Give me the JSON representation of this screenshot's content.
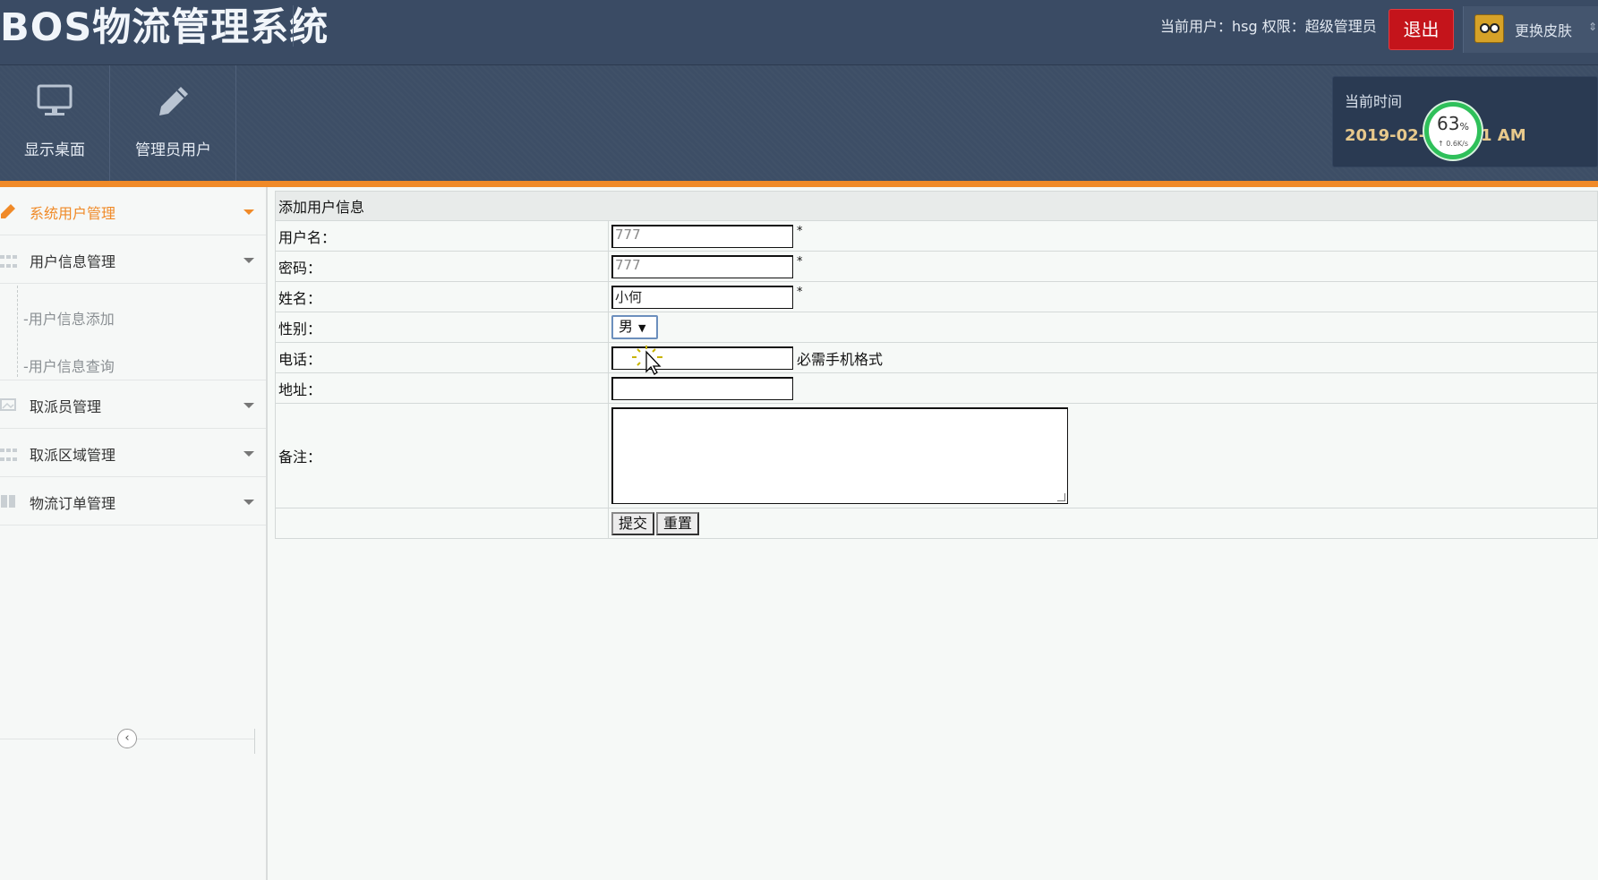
{
  "header": {
    "app_title": "BOS物流管理系统",
    "user_info": "当前用户：hsg  权限：超级管理员",
    "logout_label": "退出",
    "skin_label": "更换皮肤"
  },
  "toolbar": {
    "desktop_label": "显示桌面",
    "desktop_icon": "monitor-icon",
    "admin_label": "管理员用户",
    "admin_icon": "pencil-icon"
  },
  "time_panel": {
    "label": "当前时间",
    "value_left": "2019-02-28",
    "value_right": "1 AM",
    "gauge_percent": "63",
    "gauge_unit": "%",
    "gauge_speed": "↑ 0.6K/s"
  },
  "sidebar": {
    "items": [
      {
        "label": "系统用户管理",
        "icon": "pencil-icon",
        "active": true
      },
      {
        "label": "用户信息管理",
        "icon": "grid-icon"
      },
      {
        "label": "取派员管理",
        "icon": "image-icon"
      },
      {
        "label": "取派区域管理",
        "icon": "grid-icon"
      },
      {
        "label": "物流订单管理",
        "icon": "columns-icon"
      }
    ],
    "sub_items": [
      "-用户信息添加",
      "-用户信息查询"
    ],
    "collapse_icon": "‹"
  },
  "form": {
    "title": "添加用户信息",
    "fields": {
      "username": {
        "label": "用户名：",
        "value": "777",
        "required": "*"
      },
      "password": {
        "label": "密码：",
        "value": "777",
        "required": "*"
      },
      "name": {
        "label": "姓名：",
        "value": "小何",
        "required": "*"
      },
      "gender": {
        "label": "性别：",
        "value": "男"
      },
      "phone": {
        "label": "电话：",
        "value": "",
        "hint": "必需手机格式"
      },
      "address": {
        "label": "地址：",
        "value": ""
      },
      "remark": {
        "label": "备注：",
        "value": ""
      }
    },
    "submit_label": "提交",
    "reset_label": "重置"
  },
  "colors": {
    "header_bg": "#3a4b64",
    "accent": "#f08a28",
    "logout_bg": "#c4141b",
    "gauge_ring": "#2fc05a"
  }
}
